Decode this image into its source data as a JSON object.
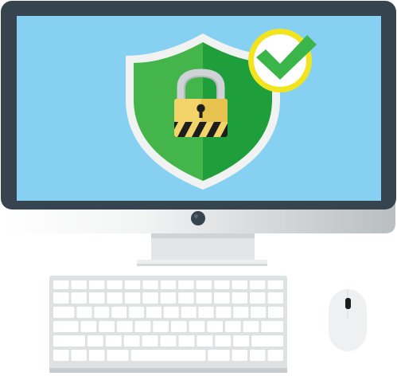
{
  "illustration": {
    "subject": "computer-security",
    "icons": [
      "shield-icon",
      "padlock-icon",
      "checkmark-icon"
    ],
    "colors": {
      "monitor_bezel": "#36444f",
      "screen": "#86d1f2",
      "shield_border": "#f1f2f2",
      "shield_green_light": "#43b54b",
      "shield_green_dark": "#1f9e3c",
      "padlock_body": "#f3d46a",
      "padlock_shackle": "#cfd3d6",
      "hazard_stripe": "#1d1d1b",
      "check_ring": "#f2e520",
      "check_mark": "#3ab54a",
      "stand": "#e3e5e6",
      "keyboard_base": "#dfe2e3",
      "keys": "#ffffff",
      "mouse": "#eef0f1",
      "power_button": "#36444f"
    }
  }
}
